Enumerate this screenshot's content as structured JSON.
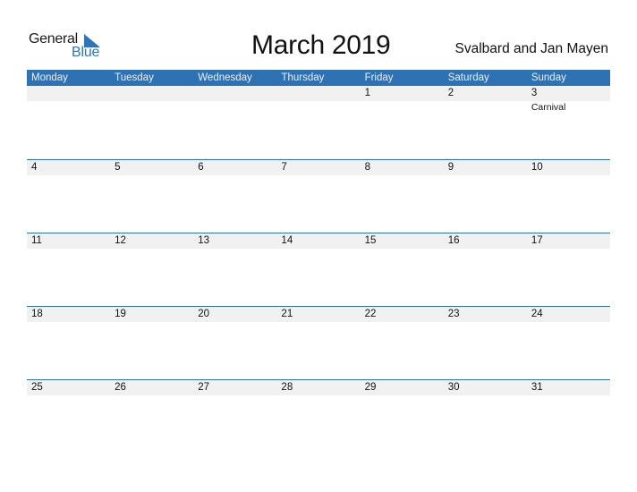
{
  "logo": {
    "general": "General",
    "blue": "Blue"
  },
  "header": {
    "title": "March 2019",
    "region": "Svalbard and Jan Mayen"
  },
  "weekdays": [
    "Monday",
    "Tuesday",
    "Wednesday",
    "Thursday",
    "Friday",
    "Saturday",
    "Sunday"
  ],
  "weeks": [
    {
      "days": [
        "",
        "",
        "",
        "",
        "1",
        "2",
        "3"
      ],
      "events": [
        "",
        "",
        "",
        "",
        "",
        "",
        "Carnival"
      ]
    },
    {
      "days": [
        "4",
        "5",
        "6",
        "7",
        "8",
        "9",
        "10"
      ],
      "events": [
        "",
        "",
        "",
        "",
        "",
        "",
        ""
      ]
    },
    {
      "days": [
        "11",
        "12",
        "13",
        "14",
        "15",
        "16",
        "17"
      ],
      "events": [
        "",
        "",
        "",
        "",
        "",
        "",
        ""
      ]
    },
    {
      "days": [
        "18",
        "19",
        "20",
        "21",
        "22",
        "23",
        "24"
      ],
      "events": [
        "",
        "",
        "",
        "",
        "",
        "",
        ""
      ]
    },
    {
      "days": [
        "25",
        "26",
        "27",
        "28",
        "29",
        "30",
        "31"
      ],
      "events": [
        "",
        "",
        "",
        "",
        "",
        "",
        ""
      ]
    }
  ],
  "colors": {
    "accent": "#2e72b4",
    "logo_blue": "#2e76b9",
    "day_strip": "#f1f1f1"
  }
}
